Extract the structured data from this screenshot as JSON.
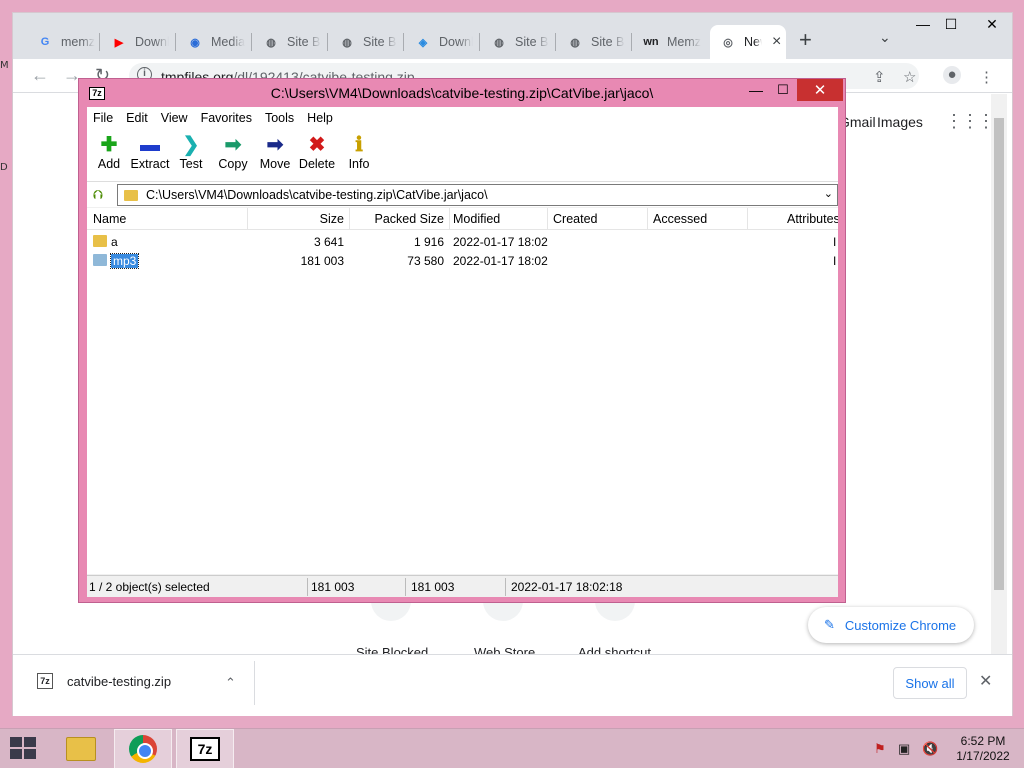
{
  "desktop": {
    "edge_chars": [
      "M",
      "D"
    ]
  },
  "chrome": {
    "tabs": [
      {
        "favicon": "G",
        "favicon_color": "#4285f4",
        "label": "memz"
      },
      {
        "favicon": "▶",
        "favicon_color": "#ff0000",
        "label": "Download"
      },
      {
        "favicon": "◉",
        "favicon_color": "#2a6cd8",
        "label": "Media"
      },
      {
        "favicon": "◍",
        "favicon_color": "#5f6368",
        "label": "Site Blocked"
      },
      {
        "favicon": "◍",
        "favicon_color": "#5f6368",
        "label": "Site Blocked"
      },
      {
        "favicon": "◈",
        "favicon_color": "#2a8be0",
        "label": "Download"
      },
      {
        "favicon": "◍",
        "favicon_color": "#5f6368",
        "label": "Site Blocked"
      },
      {
        "favicon": "◍",
        "favicon_color": "#5f6368",
        "label": "Site Blocked"
      },
      {
        "favicon": "wn",
        "favicon_color": "#202124",
        "label": "Memz"
      },
      {
        "favicon": "◎",
        "favicon_color": "#5f6368",
        "label": "New Tab",
        "active": true
      }
    ],
    "new_tab_label": "+",
    "tab_list_icon": "⌄",
    "window": {
      "min": "—",
      "max": "☐",
      "close": "✕"
    },
    "address": {
      "host": "tmpfiles.org",
      "path": "/dl/192413/catvibe-testing.zip",
      "info_icon": "i"
    },
    "page": {
      "gmail": "Gmail",
      "images": "Images",
      "shortcuts": [
        "Site Blocked",
        "Web Store",
        "Add shortcut"
      ],
      "customize": "Customize Chrome"
    },
    "download": {
      "filename": "catvibe-testing.zip",
      "show_all": "Show all"
    }
  },
  "sevenzip": {
    "title": "C:\\Users\\VM4\\Downloads\\catvibe-testing.zip\\CatVibe.jar\\jaco\\",
    "menu": [
      "File",
      "Edit",
      "View",
      "Favorites",
      "Tools",
      "Help"
    ],
    "tools": [
      {
        "label": "Add",
        "glyph": "✚",
        "color": "#1aa51a"
      },
      {
        "label": "Extract",
        "glyph": "▬",
        "color": "#1e3ccc"
      },
      {
        "label": "Test",
        "glyph": "❯",
        "color": "#1ab0b0"
      },
      {
        "label": "Copy",
        "glyph": "➡",
        "color": "#1a9a6a"
      },
      {
        "label": "Move",
        "glyph": "➡",
        "color": "#1a2a8a"
      },
      {
        "label": "Delete",
        "glyph": "✖",
        "color": "#d21a1a"
      },
      {
        "label": "Info",
        "glyph": "ℹ",
        "color": "#c8a000"
      }
    ],
    "path": "C:\\Users\\VM4\\Downloads\\catvibe-testing.zip\\CatVibe.jar\\jaco\\",
    "columns": [
      "Name",
      "Size",
      "Packed Size",
      "Modified",
      "Created",
      "Accessed",
      "Attributes"
    ],
    "rows": [
      {
        "name": "a",
        "size": "3 641",
        "packed": "1 916",
        "modified": "2022-01-17 18:02",
        "folder_color": "#e8c048",
        "selected": false
      },
      {
        "name": "mp3",
        "size": "181 003",
        "packed": "73 580",
        "modified": "2022-01-17 18:02",
        "folder_color": "#8fb8d8",
        "selected": true
      }
    ],
    "status": {
      "selection": "1 / 2 object(s) selected",
      "size": "181 003",
      "packed": "181 003",
      "modified": "2022-01-17 18:02:18"
    }
  },
  "taskbar": {
    "clock_time": "6:52 PM",
    "clock_date": "1/17/2022",
    "tray": [
      "⚑",
      "▣",
      "🔇"
    ]
  }
}
